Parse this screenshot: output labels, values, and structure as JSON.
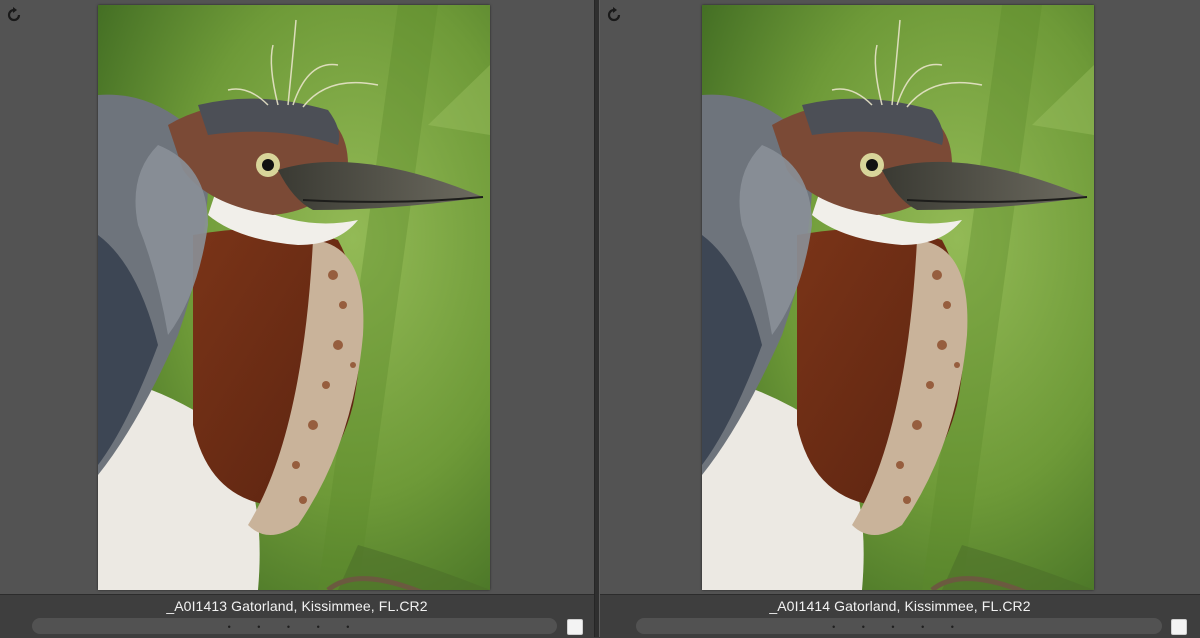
{
  "left_panel": {
    "filename": "_A0I1413 Gatorland, Kissimmee, FL.CR2",
    "rotate_icon": "rotate-icon",
    "dots": "• • • • •"
  },
  "right_panel": {
    "filename": "_A0I1414 Gatorland, Kissimmee, FL.CR2",
    "rotate_icon": "rotate-icon",
    "dots": "• • • • •"
  },
  "colors": {
    "panel_bg": "#535353",
    "info_bar_bg": "#3e3e3e",
    "filename_text": "#f2f2f2"
  }
}
